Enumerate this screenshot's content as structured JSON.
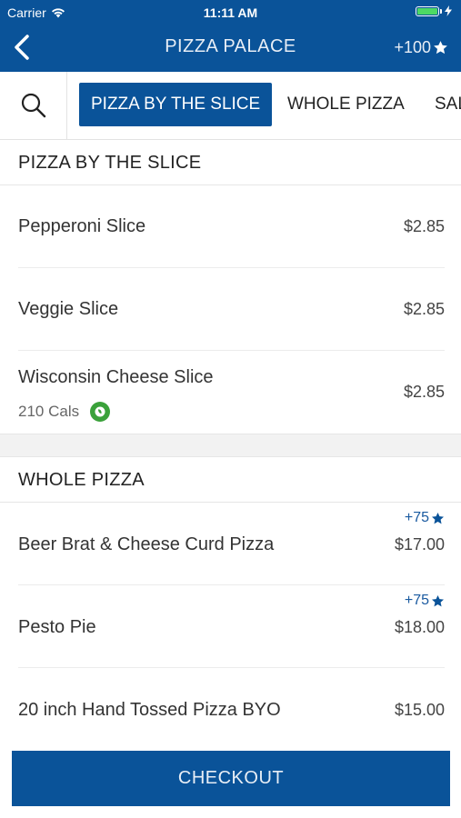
{
  "status_bar": {
    "carrier": "Carrier",
    "time": "11:11 AM"
  },
  "nav": {
    "title": "PIZZA PALACE",
    "points": "+100"
  },
  "tabs": [
    {
      "label": "PIZZA BY THE SLICE",
      "active": true
    },
    {
      "label": "WHOLE PIZZA",
      "active": false
    },
    {
      "label": "SAL",
      "active": false
    }
  ],
  "sections": [
    {
      "title": "PIZZA BY THE SLICE",
      "items": [
        {
          "name": "Pepperoni Slice",
          "price": "$2.85"
        },
        {
          "name": "Veggie Slice",
          "price": "$2.85"
        },
        {
          "name": "Wisconsin Cheese Slice",
          "price": "$2.85",
          "cals": "210 Cals"
        }
      ]
    },
    {
      "title": "WHOLE PIZZA",
      "items": [
        {
          "name": "Beer Brat & Cheese Curd Pizza",
          "price": "$17.00",
          "bonus": "+75"
        },
        {
          "name": "Pesto Pie",
          "price": "$18.00",
          "bonus": "+75"
        },
        {
          "name": "20 inch Hand Tossed Pizza BYO",
          "price": "$15.00"
        }
      ]
    }
  ],
  "checkout_label": "CHECKOUT",
  "colors": {
    "brand": "#0a5399",
    "battery": "#4cd964",
    "veg": "#3aa13a"
  }
}
